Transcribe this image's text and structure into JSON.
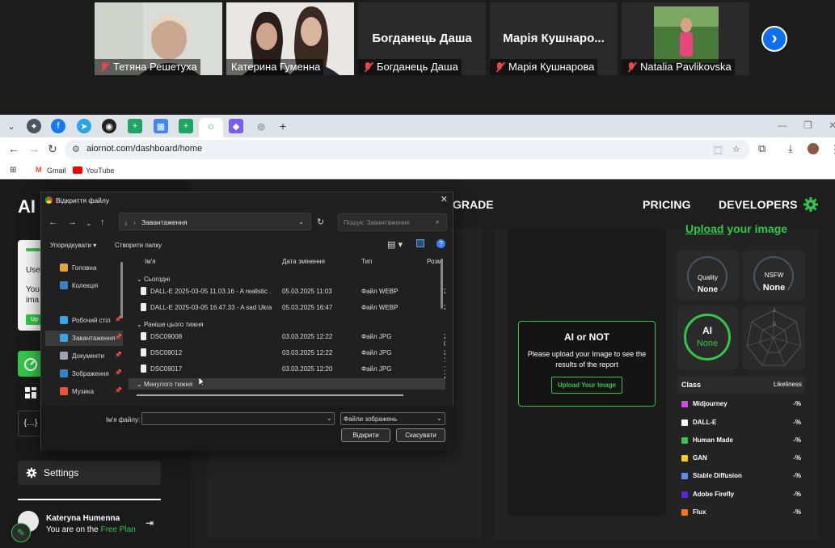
{
  "meeting": {
    "participants": [
      {
        "name": "Тетяна Решетуха",
        "display": ""
      },
      {
        "name": "Катерина Гуменна",
        "display": ""
      },
      {
        "name": "Богданець Даша",
        "display": "Богданець Даша"
      },
      {
        "name": "Марія Кушнарова",
        "display": "Марія  Кушнаро..."
      },
      {
        "name": "Natalia Pavlikovska",
        "display": ""
      }
    ]
  },
  "browser": {
    "url": "aiornot.com/dashboard/home",
    "bookmarks": [
      "Gmail",
      "YouTube"
    ]
  },
  "site": {
    "brand": "AI",
    "nav": {
      "upgrade": "GRADE",
      "pricing": "PRICING",
      "developers": "DEVELOPERS"
    },
    "user_card_lines": [
      "Use",
      "You",
      "ima",
      "Up"
    ],
    "settings_label": "Settings",
    "profile": {
      "name": "Kateryna Humenna",
      "plan_prefix": "You are on the ",
      "plan": "Free Plan"
    },
    "upload_link": "Upload",
    "upload_link_rest": " your image",
    "report": {
      "title": "AI or NOT",
      "text": "Please upload your Image to see the results of the report",
      "button": "Upload Your Image"
    },
    "metrics": {
      "quality_label": "Quality",
      "quality_value": "None",
      "nsfw_label": "NSFW",
      "nsfw_value": "None",
      "ai_label": "AI",
      "ai_value": "None",
      "radar_ticks": [
        "1",
        "0"
      ]
    },
    "class_table": {
      "header_left": "Class",
      "header_right": "Likeliness",
      "rows": [
        {
          "name": "Midjourney",
          "value": "-%",
          "color": "#d946ef"
        },
        {
          "name": "DALL-E",
          "value": "-%",
          "color": "#ffffff"
        },
        {
          "name": "Human Made",
          "value": "-%",
          "color": "#34c54a"
        },
        {
          "name": "GAN",
          "value": "-%",
          "color": "#facc15"
        },
        {
          "name": "Stable Diffusion",
          "value": "-%",
          "color": "#5b8def"
        },
        {
          "name": "Adobe Firefly",
          "value": "-%",
          "color": "#5b21e6"
        },
        {
          "name": "Flux",
          "value": "-%",
          "color": "#f97316"
        }
      ]
    }
  },
  "dialog": {
    "title": "Відкриття файлу",
    "path": "Завантаження",
    "search_placeholder": "Пошук: Завантаження",
    "organize": "Упорядкувати ▾",
    "new_folder": "Створити папку",
    "sidebar": [
      {
        "label": "Головна",
        "color": "#e8a33d"
      },
      {
        "label": "Колекція",
        "color": "#3b82c4"
      },
      {
        "label": "Робочий стіл",
        "color": "#3ba3e8"
      },
      {
        "label": "Завантаження",
        "color": "#3ba3e8"
      },
      {
        "label": "Документи",
        "color": "#9aa3b0"
      },
      {
        "label": "Зображення",
        "color": "#3b82c4"
      },
      {
        "label": "Музика",
        "color": "#e8553d"
      }
    ],
    "columns": [
      "Ім'я",
      "Дата змінення",
      "Тип",
      "Розмі"
    ],
    "groups": [
      "Сьогодні",
      "Раніше цього тижня",
      "Минулого тижня"
    ],
    "files": [
      {
        "name": "DALL-E 2025-03-05 11.03.16 - A realistic ...",
        "date": "05.03.2025 11:03",
        "type": "Файл WEBP",
        "size": "2"
      },
      {
        "name": "DALL-E 2025-03-05 16.47.33 - A sad Ukrai...",
        "date": "05.03.2025 16:47",
        "type": "Файл WEBP",
        "size": "2"
      },
      {
        "name": "DSC09008",
        "date": "03.03.2025 12:22",
        "type": "Файл JPG",
        "size": "2 0"
      },
      {
        "name": "DSC09012",
        "date": "03.03.2025 12:22",
        "type": "Файл JPG",
        "size": "2 1"
      },
      {
        "name": "DSC09017",
        "date": "03.03.2025 12:20",
        "type": "Файл JPG",
        "size": "1 2"
      }
    ],
    "filename_label": "Ім'я файлу:",
    "filename_value": "",
    "filetype": "Файли зображень",
    "open_button": "Відкрити",
    "cancel_button": "Скасувати"
  }
}
